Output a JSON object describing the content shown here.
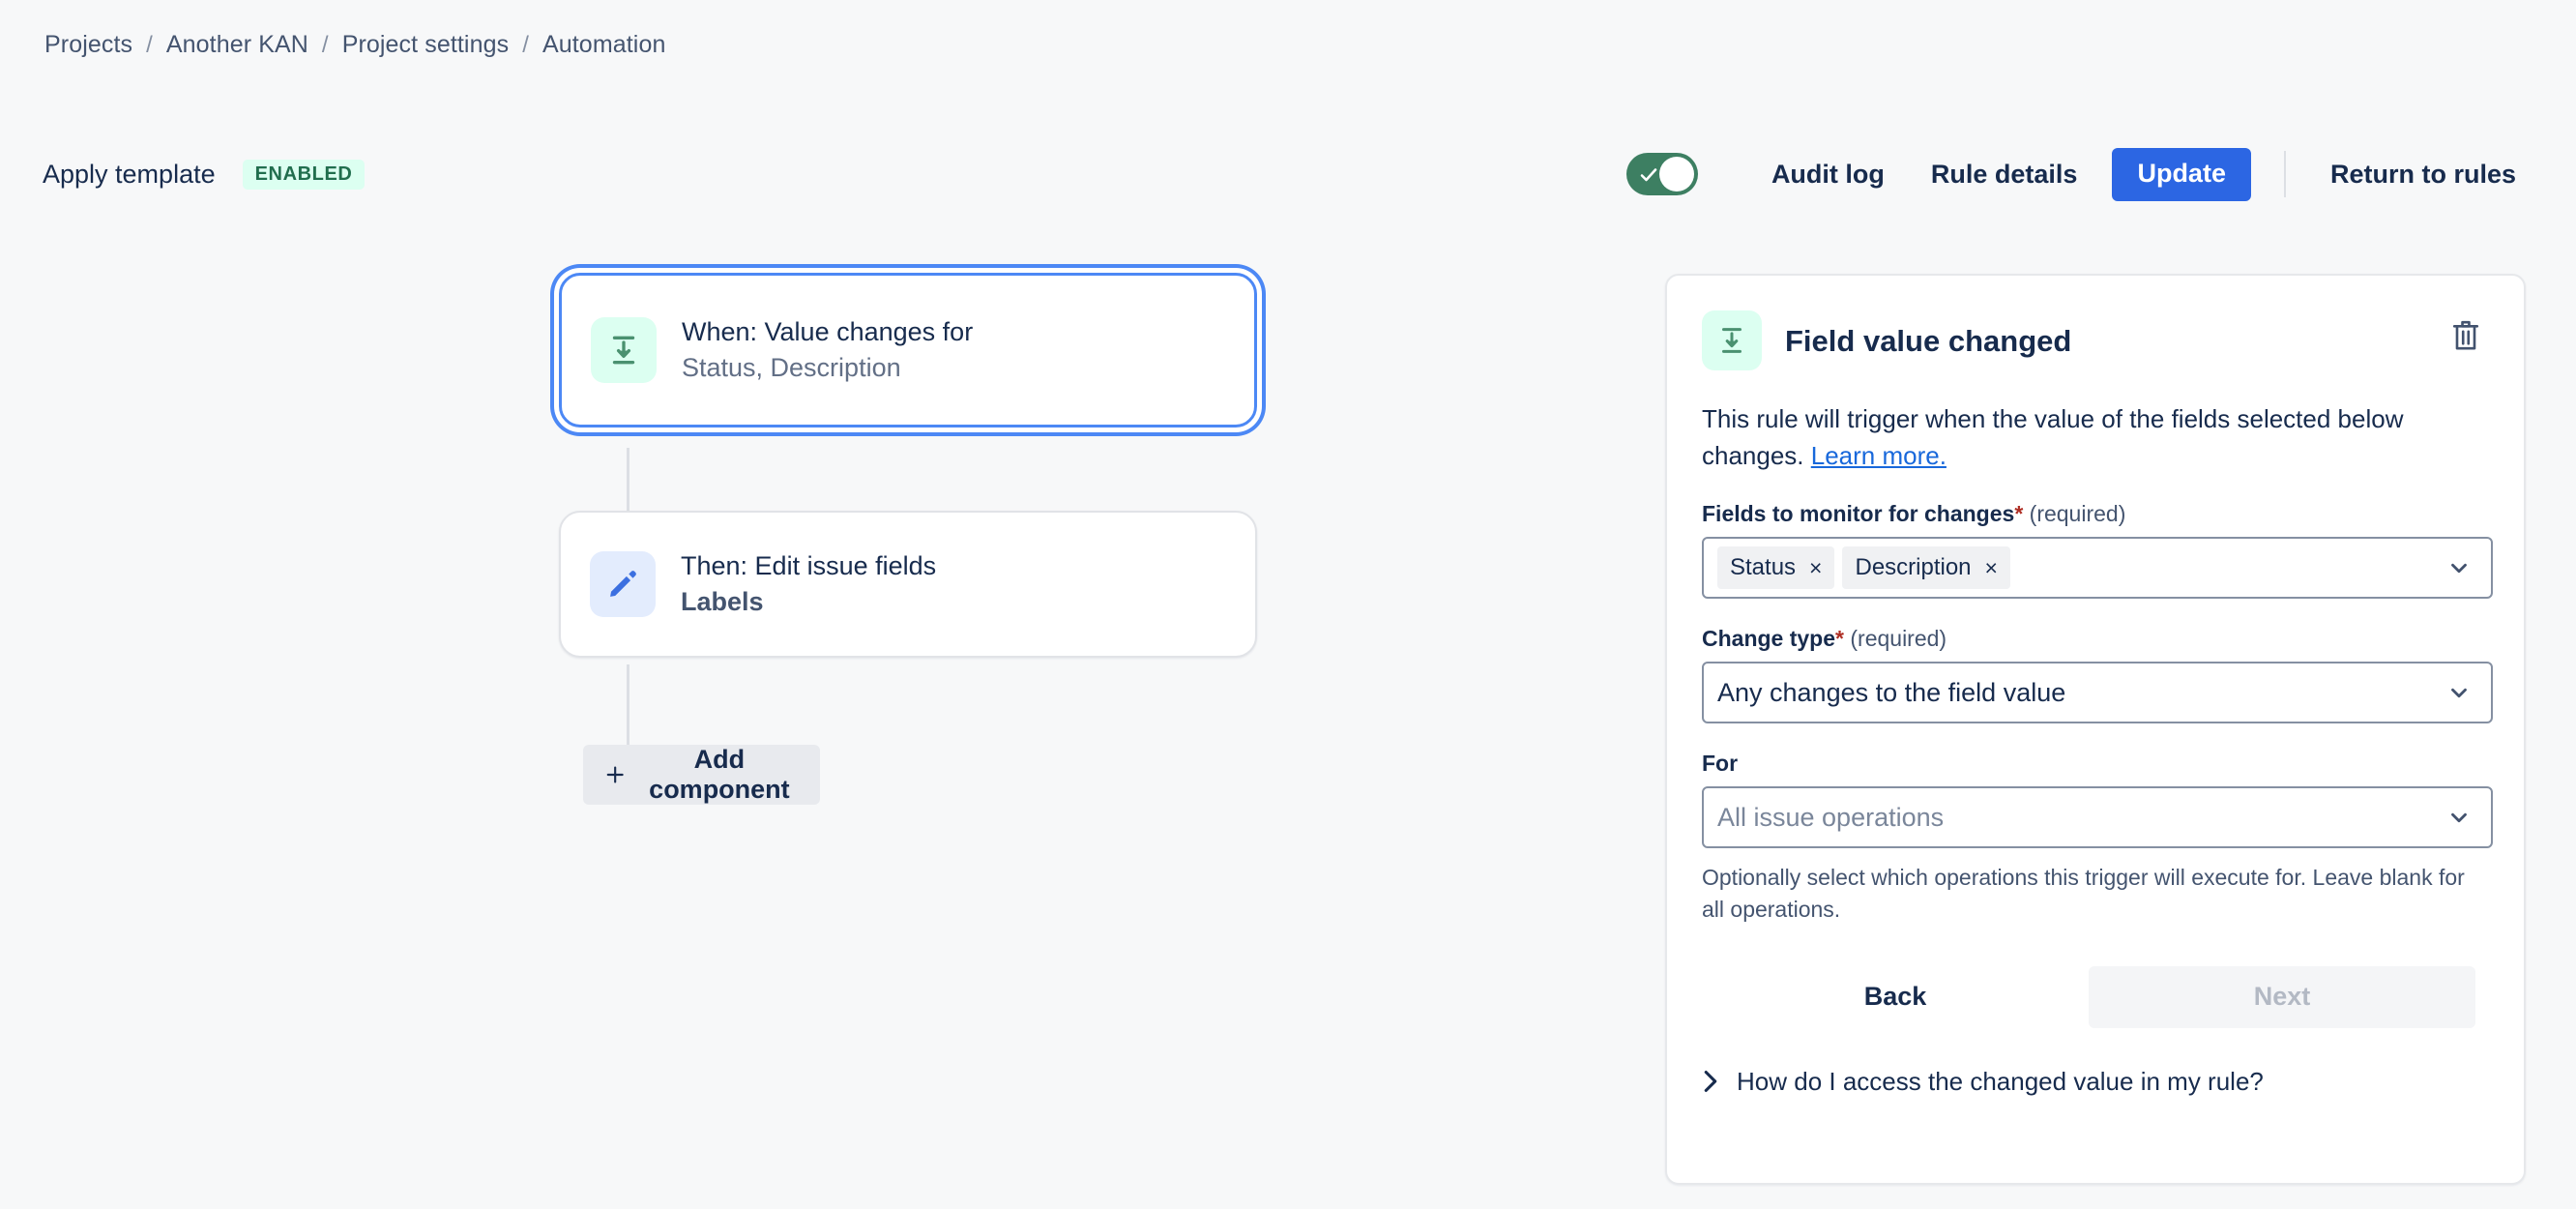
{
  "breadcrumb": {
    "items": [
      {
        "label": "Projects"
      },
      {
        "label": "Another KAN"
      },
      {
        "label": "Project settings"
      },
      {
        "label": "Automation"
      }
    ],
    "separator": "/"
  },
  "toolbar": {
    "rule_name": "Apply template",
    "status_badge": "ENABLED",
    "toggle_state": "on",
    "audit_log_label": "Audit log",
    "rule_details_label": "Rule details",
    "update_label": "Update",
    "return_label": "Return to rules",
    "primary_color": "#2c66e3",
    "toggle_color": "#3d7f62",
    "badge_bg": "#dcfff1",
    "badge_fg": "#216e4e"
  },
  "chain": {
    "trigger": {
      "title": "When: Value changes for",
      "subtitle": "Status, Description",
      "icon": "field-value-changed-icon",
      "selected": true
    },
    "action": {
      "title": "Then: Edit issue fields",
      "subtitle": "Labels",
      "icon": "pencil-icon",
      "selected": false
    },
    "add_component_label": "Add component"
  },
  "panel": {
    "icon": "field-value-changed-icon",
    "title": "Field value changed",
    "delete_icon": "trash-icon",
    "description_before": "This rule will trigger when the value of the fields selected below changes. ",
    "description_link": "Learn more.",
    "fields_label": "Fields to monitor for changes",
    "fields_required_star": "*",
    "fields_required_word": "(required)",
    "fields_chips": [
      {
        "label": "Status",
        "remove": "×"
      },
      {
        "label": "Description",
        "remove": "×"
      }
    ],
    "change_type_label": "Change type",
    "change_type_required_star": "*",
    "change_type_required_word": "(required)",
    "change_type_value": "Any changes to the field value",
    "for_label": "For",
    "for_placeholder": "All issue operations",
    "for_help": "Optionally select which operations this trigger will execute for. Leave blank for all operations.",
    "back_label": "Back",
    "next_label": "Next",
    "next_disabled": true,
    "expander_label": "How do I access the changed value in my rule?"
  }
}
